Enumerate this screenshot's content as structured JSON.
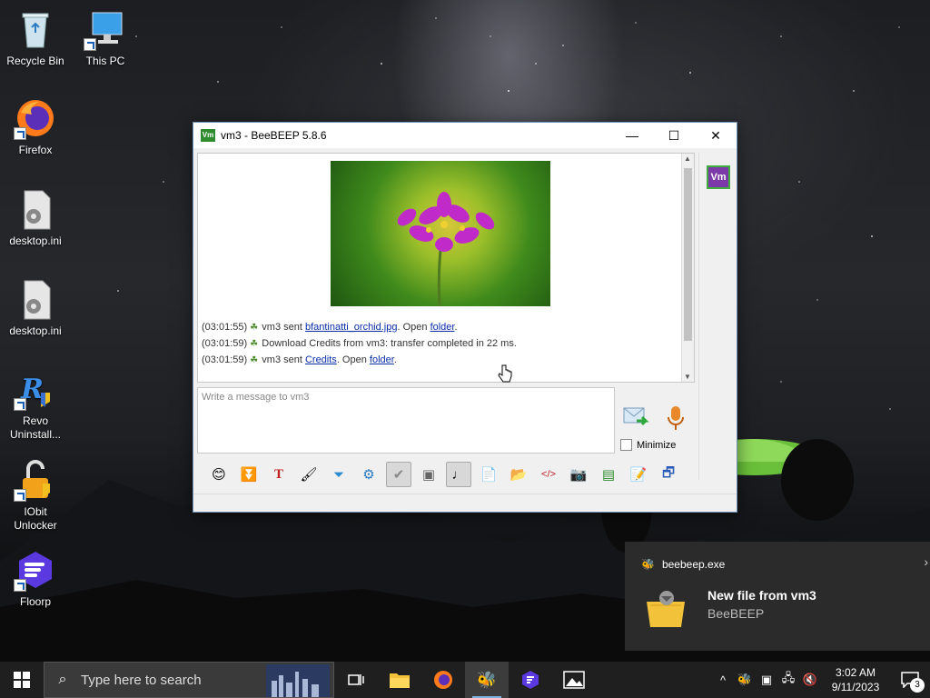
{
  "desktop": {
    "icons": [
      {
        "label": "Recycle Bin"
      },
      {
        "label": "This PC"
      },
      {
        "label": "Firefox"
      },
      {
        "label": "desktop.ini"
      },
      {
        "label": "desktop.ini"
      },
      {
        "label": "Revo Uninstall..."
      },
      {
        "label": "IObit Unlocker"
      },
      {
        "label": "Floorp"
      }
    ]
  },
  "window": {
    "app_icon_text": "Vm",
    "title": "vm3 - BeeBEEP 5.8.6",
    "minimize_glyph": "—",
    "maximize_glyph": "☐",
    "close_glyph": "✕",
    "messages": [
      {
        "time": "(03:01:55)",
        "pre": "vm3 sent ",
        "link": "bfantinatti_orchid.jpg",
        "mid": ". Open ",
        "link2": "folder",
        "post": "."
      },
      {
        "time": "(03:01:59)",
        "text": "Download Credits from vm3: transfer completed in 22 ms."
      },
      {
        "time": "(03:01:59)",
        "pre": "vm3 sent ",
        "link": "Credits",
        "mid": ". Open ",
        "link2": "folder",
        "post": "."
      }
    ],
    "input_placeholder": "Write a message to vm3",
    "minimize_label": "Minimize",
    "user_badge": "Vm"
  },
  "toast": {
    "app": "beebeep.exe",
    "title": "New file from vm3",
    "subtitle": "BeeBEEP"
  },
  "taskbar": {
    "search_placeholder": "Type here to search",
    "time": "3:02 AM",
    "date": "9/11/2023",
    "notification_count": "3"
  }
}
